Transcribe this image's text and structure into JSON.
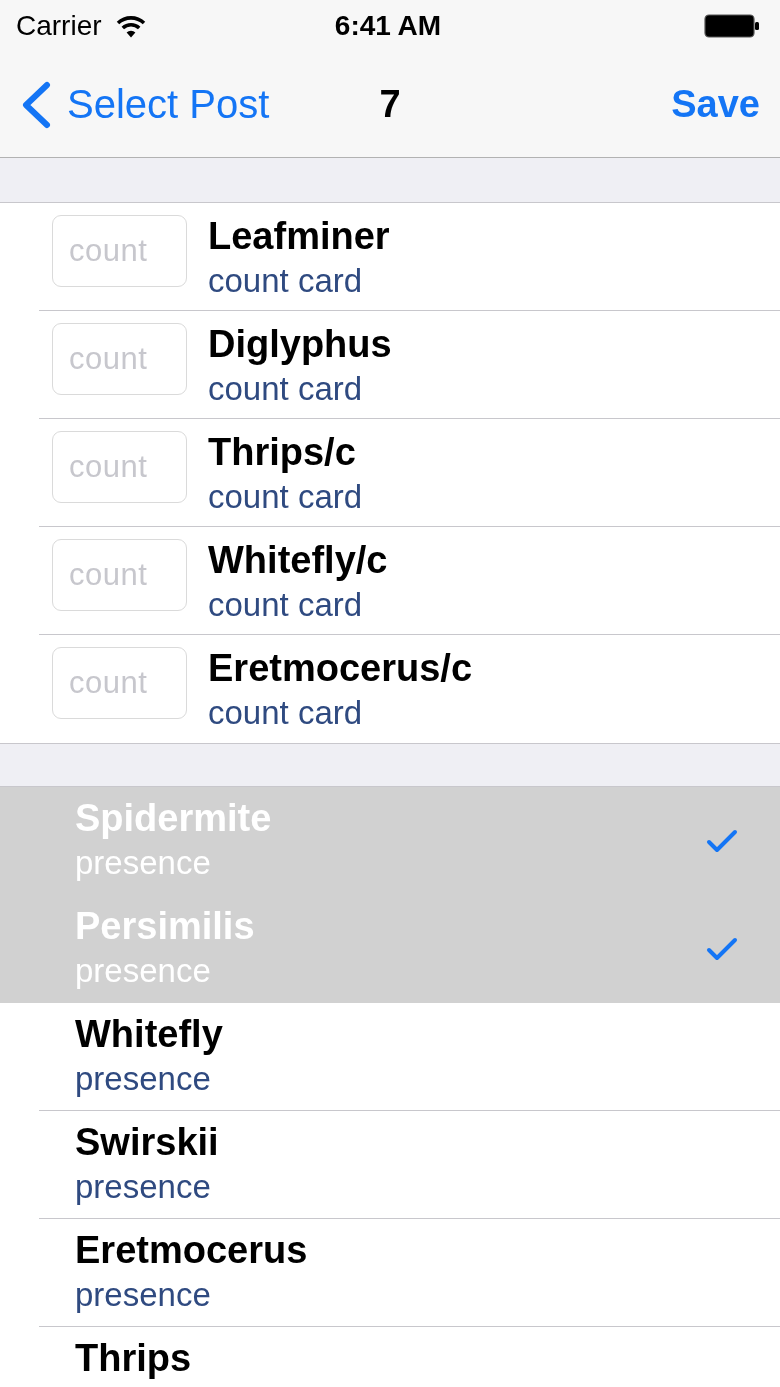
{
  "status_bar": {
    "carrier": "Carrier",
    "time": "6:41 AM"
  },
  "navigation_bar": {
    "back": "Select Post",
    "title": "7",
    "action": "Save"
  },
  "sections": [
    {
      "kind": "count",
      "rows": [
        {
          "name": "Leafminer",
          "detail": "count card",
          "field": {
            "placeholder": "count"
          }
        },
        {
          "name": "Diglyphus",
          "detail": "count card",
          "field": {
            "placeholder": "count"
          }
        },
        {
          "name": "Thrips/c",
          "detail": "count card",
          "field": {
            "placeholder": "count"
          }
        },
        {
          "name": "Whitefly/c",
          "detail": "count card",
          "field": {
            "placeholder": "count"
          }
        },
        {
          "name": "Eretmocerus/c",
          "detail": "count card",
          "field": {
            "placeholder": "count"
          }
        }
      ]
    },
    {
      "kind": "presence",
      "rows": [
        {
          "name": "Spidermite",
          "detail": "presence",
          "selected": true
        },
        {
          "name": "Persimilis",
          "detail": "presence",
          "selected": true
        },
        {
          "name": "Whitefly",
          "detail": "presence",
          "selected": false
        },
        {
          "name": "Swirskii",
          "detail": "presence",
          "selected": false
        },
        {
          "name": "Eretmocerus",
          "detail": "presence",
          "selected": false
        },
        {
          "name": "Thrips",
          "selected": false
        }
      ]
    }
  ]
}
